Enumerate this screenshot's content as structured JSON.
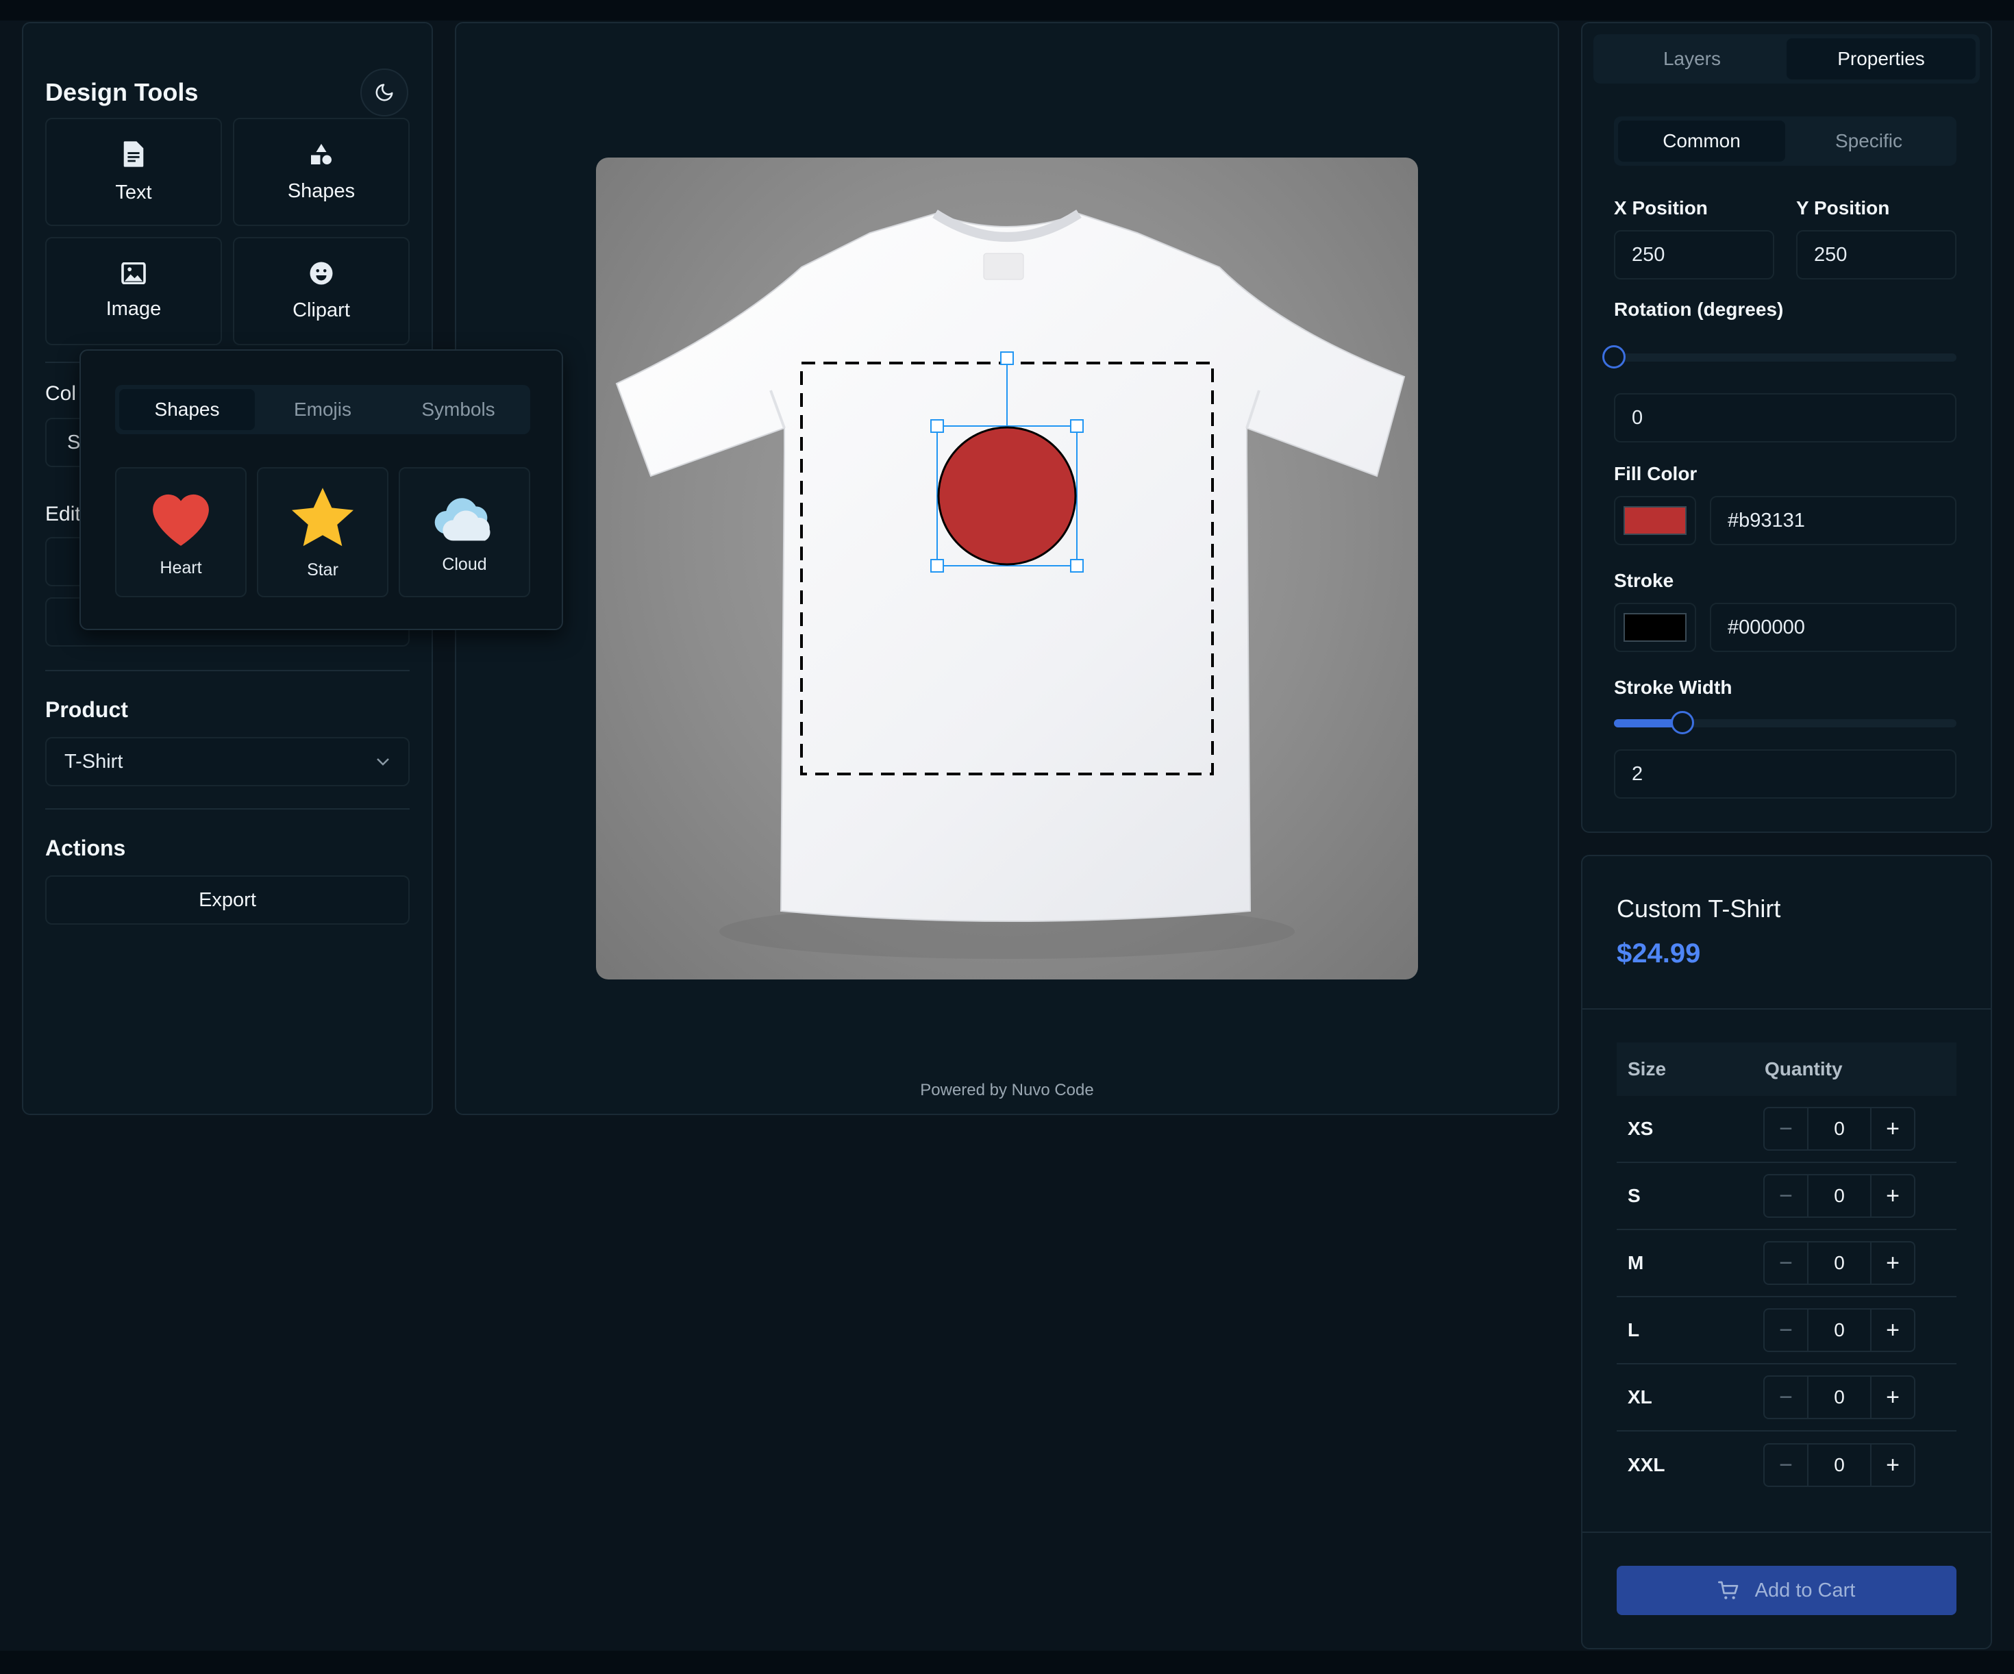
{
  "left": {
    "title": "Design Tools",
    "tools": [
      {
        "label": "Text",
        "icon": "document-icon"
      },
      {
        "label": "Shapes",
        "icon": "shapes-icon"
      },
      {
        "label": "Image",
        "icon": "image-icon"
      },
      {
        "label": "Clipart",
        "icon": "smiley-icon"
      }
    ],
    "color_label_partial": "Col",
    "color_field_partial": "S",
    "edit_label_partial": "Edit",
    "product_heading": "Product",
    "product_value": "T-Shirt",
    "actions_heading": "Actions",
    "export_label": "Export"
  },
  "popup": {
    "tabs": [
      "Shapes",
      "Emojis",
      "Symbols"
    ],
    "active_tab": "Shapes",
    "items": [
      {
        "label": "Heart",
        "icon": "heart-icon"
      },
      {
        "label": "Star",
        "icon": "star-icon"
      },
      {
        "label": "Cloud",
        "icon": "cloud-icon"
      }
    ]
  },
  "canvas": {
    "powered_by": "Powered by Nuvo Code",
    "selected_shape": {
      "type": "circle",
      "fill": "#b93131",
      "stroke": "#000000"
    }
  },
  "properties": {
    "tabs": [
      "Layers",
      "Properties"
    ],
    "active_tab": "Properties",
    "subtabs": [
      "Common",
      "Specific"
    ],
    "active_subtab": "Common",
    "x_label": "X Position",
    "x_value": "250",
    "y_label": "Y Position",
    "y_value": "250",
    "rotation_label": "Rotation (degrees)",
    "rotation_value": "0",
    "rotation_fraction": 0,
    "fill_label": "Fill Color",
    "fill_value": "#b93131",
    "stroke_label": "Stroke",
    "stroke_value": "#000000",
    "stroke_width_label": "Stroke Width",
    "stroke_width_value": "2",
    "stroke_width_fraction": 0.2
  },
  "product": {
    "title": "Custom T-Shirt",
    "price": "$24.99",
    "size_header": "Size",
    "quantity_header": "Quantity",
    "sizes": [
      {
        "size": "XS",
        "qty": "0"
      },
      {
        "size": "S",
        "qty": "0"
      },
      {
        "size": "M",
        "qty": "0"
      },
      {
        "size": "L",
        "qty": "0"
      },
      {
        "size": "XL",
        "qty": "0"
      },
      {
        "size": "XXL",
        "qty": "0"
      }
    ],
    "add_to_cart": "Add to Cart"
  },
  "colors": {
    "background": "#0a141c",
    "accent": "#4f86f7",
    "cart_button": "#27479a"
  }
}
